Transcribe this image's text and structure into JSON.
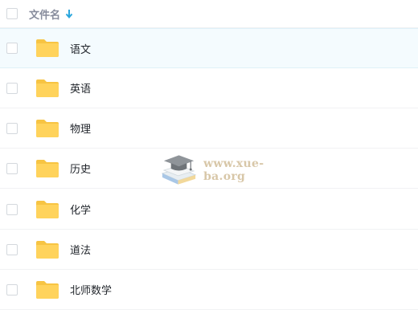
{
  "header": {
    "column_label": "文件名",
    "sort_icon": "arrow-down-icon",
    "sort_color": "#2aa6dd"
  },
  "rows": [
    {
      "name": "语文",
      "icon": "folder-icon",
      "selected": true
    },
    {
      "name": "英语",
      "icon": "folder-icon",
      "selected": false
    },
    {
      "name": "物理",
      "icon": "folder-icon",
      "selected": false
    },
    {
      "name": "历史",
      "icon": "folder-icon",
      "selected": false
    },
    {
      "name": "化学",
      "icon": "folder-icon",
      "selected": false
    },
    {
      "name": "道法",
      "icon": "folder-icon",
      "selected": false
    },
    {
      "name": "北师数学",
      "icon": "folder-icon",
      "selected": false
    }
  ],
  "watermark": {
    "text": "www.xue-ba.org",
    "icon": "graduation-cap-book-logo"
  },
  "colors": {
    "folder": "#ffd35c",
    "folder_tab": "#f7c443",
    "selected_row": "#f4fbfe"
  }
}
